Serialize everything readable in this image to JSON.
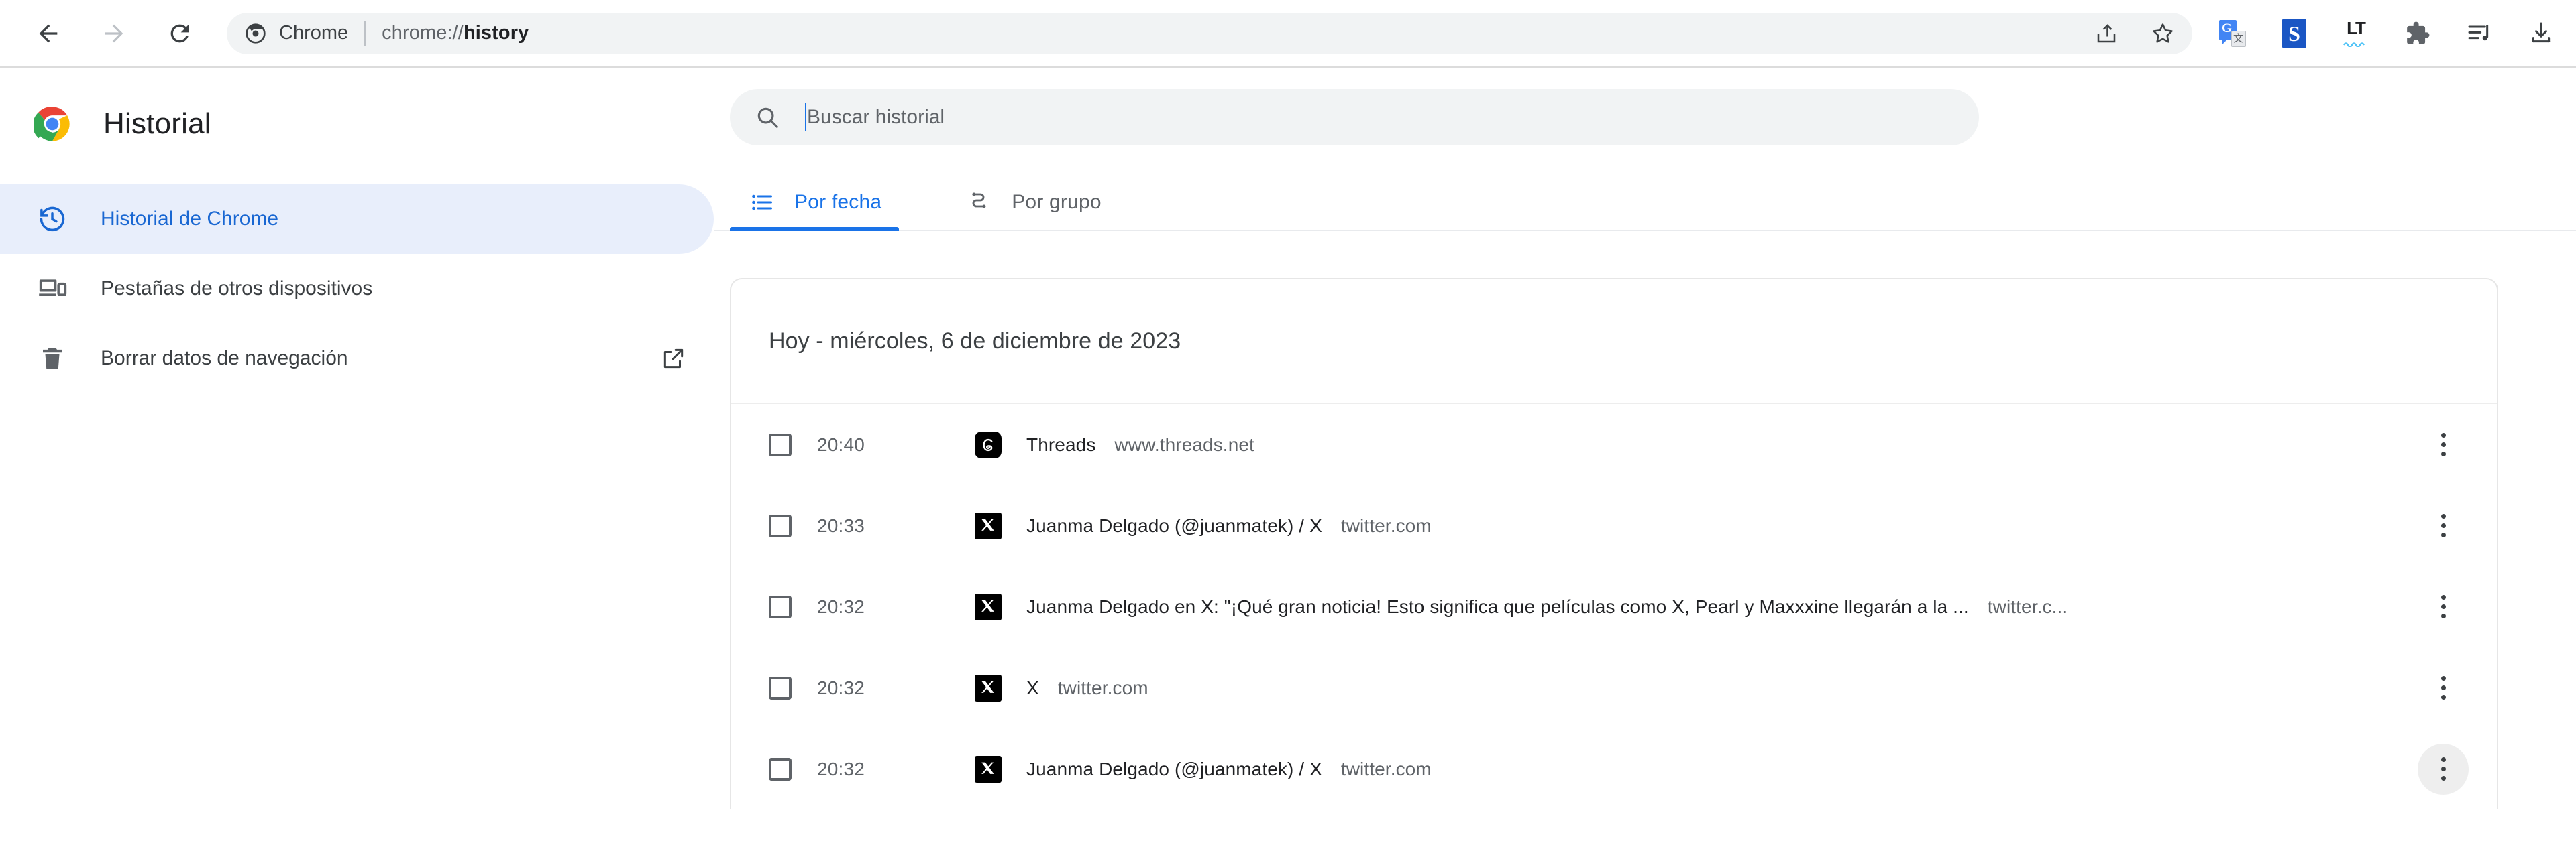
{
  "browser": {
    "nav": {
      "back": "back-arrow",
      "forward": "forward-arrow",
      "reload": "reload"
    },
    "omnibox": {
      "app_label": "Chrome",
      "url_prefix": "chrome://",
      "url_page": "history",
      "url_full": "chrome://history"
    },
    "toolbar_icons": [
      {
        "name": "share-icon",
        "label": "Compartir esta página"
      },
      {
        "name": "bookmark-star-icon",
        "label": "Añadir a favoritos"
      },
      {
        "name": "google-translate-extension-icon",
        "label": "Google Translate"
      },
      {
        "name": "s-extension-icon",
        "label": "S"
      },
      {
        "name": "languagetool-extension-icon",
        "label": "LT"
      },
      {
        "name": "extensions-puzzle-icon",
        "label": "Extensiones"
      },
      {
        "name": "media-playlist-icon",
        "label": "Controles multimedia"
      },
      {
        "name": "downloads-icon",
        "label": "Descargas"
      }
    ]
  },
  "sidebar": {
    "brand_title": "Historial",
    "items": [
      {
        "label": "Historial de Chrome",
        "icon": "history-clock-icon",
        "active": true,
        "external": false
      },
      {
        "label": "Pestañas de otros dispositivos",
        "icon": "devices-icon",
        "active": false,
        "external": false
      },
      {
        "label": "Borrar datos de navegación",
        "icon": "trash-icon",
        "active": false,
        "external": true,
        "external_icon": "open-in-new-icon"
      }
    ]
  },
  "search": {
    "placeholder": "Buscar historial",
    "value": "",
    "icon": "search-icon"
  },
  "tabs": [
    {
      "label": "Por fecha",
      "icon": "list-icon",
      "active": true
    },
    {
      "label": "Por grupo",
      "icon": "group-path-icon",
      "active": false
    }
  ],
  "history": {
    "group_title": "Hoy - miércoles, 6 de diciembre de 2023",
    "rows": [
      {
        "time": "20:40",
        "favicon": "threads-icon",
        "title": "Threads",
        "domain": "www.threads.net",
        "checked": false,
        "menu_hovered": false
      },
      {
        "time": "20:33",
        "favicon": "x-twitter-icon",
        "title": "Juanma Delgado (@juanmatek) / X",
        "domain": "twitter.com",
        "checked": false,
        "menu_hovered": false
      },
      {
        "time": "20:32",
        "favicon": "x-twitter-icon",
        "title": "Juanma Delgado en X: \"¡Qué gran noticia! Esto significa que películas como X, Pearl y Maxxxine llegarán a la ...",
        "domain": "twitter.c...",
        "checked": false,
        "menu_hovered": false
      },
      {
        "time": "20:32",
        "favicon": "x-twitter-icon",
        "title": "X",
        "domain": "twitter.com",
        "checked": false,
        "menu_hovered": false
      },
      {
        "time": "20:32",
        "favicon": "x-twitter-icon",
        "title": "Juanma Delgado (@juanmatek) / X",
        "domain": "twitter.com",
        "checked": false,
        "menu_hovered": true
      }
    ]
  },
  "colors": {
    "accent_blue": "#1a73e8",
    "active_pill_bg": "#e8eefb",
    "active_pill_text": "#1967d2",
    "text_primary": "#202124",
    "text_secondary": "#5f6368",
    "field_bg": "#f1f3f4",
    "card_border": "#e6e6e6"
  }
}
